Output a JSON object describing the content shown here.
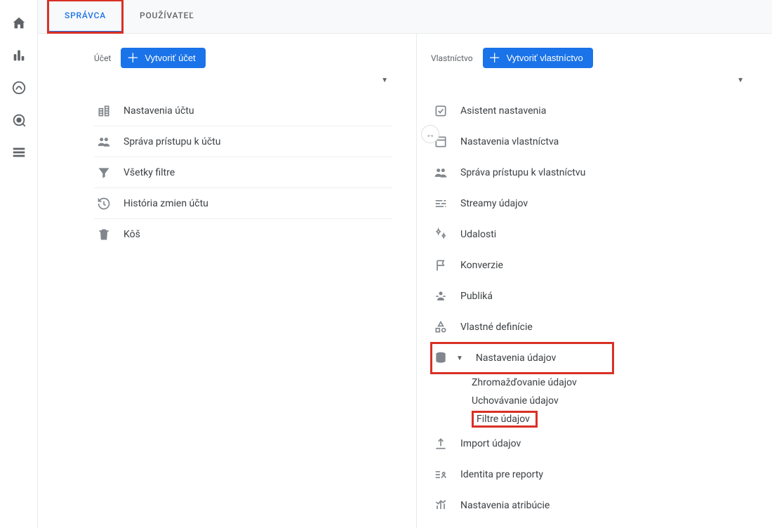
{
  "tabs": {
    "admin": "SPRÁVCA",
    "user": "POUŽÍVATEĽ"
  },
  "account": {
    "label": "Účet",
    "create_btn": "Vytvoriť účet",
    "items": {
      "settings": "Nastavenia účtu",
      "access": "Správa prístupu k účtu",
      "filters": "Všetky filtre",
      "history": "História zmien účtu",
      "trash": "Kôš"
    }
  },
  "property": {
    "label": "Vlastníctvo",
    "create_btn": "Vytvoriť vlastníctvo",
    "items": {
      "assistant": "Asistent nastavenia",
      "settings": "Nastavenia vlastníctva",
      "access": "Správa prístupu k vlastníctvu",
      "streams": "Streamy údajov",
      "events": "Udalosti",
      "conversions": "Konverzie",
      "audiences": "Publiká",
      "custom_defs": "Vlastné definície",
      "data_settings": "Nastavenia údajov",
      "data_settings_children": {
        "collection": "Zhromažďovanie údajov",
        "retention": "Uchovávanie údajov",
        "filters": "Filtre údajov"
      },
      "import": "Import údajov",
      "identity": "Identita pre reporty",
      "attribution": "Nastavenia atribúcie"
    }
  }
}
